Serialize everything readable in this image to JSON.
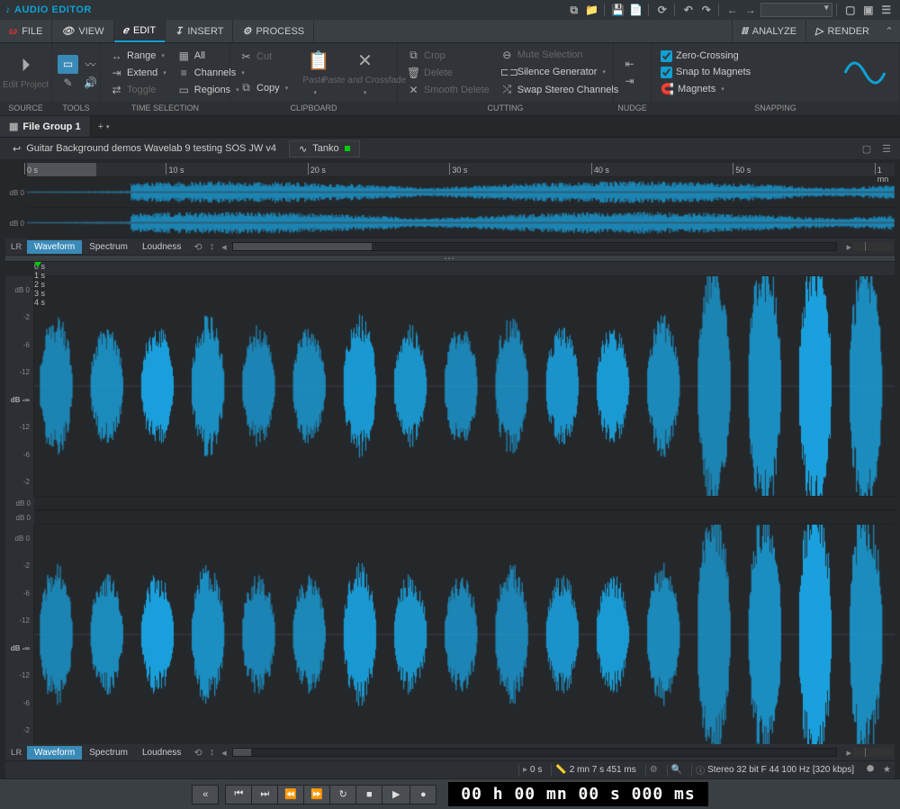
{
  "title": "AUDIO EDITOR",
  "tabs": {
    "file": "FILE",
    "view": "VIEW",
    "edit": "EDIT",
    "insert": "INSERT",
    "process": "PROCESS",
    "analyze": "ANALYZE",
    "render": "RENDER"
  },
  "ribbon": {
    "source": {
      "label": "SOURCE",
      "edit_project": "Edit Project"
    },
    "tools": {
      "label": "TOOLS"
    },
    "time_selection": {
      "label": "TIME SELECTION",
      "range": "Range",
      "all": "All",
      "extend": "Extend",
      "channels": "Channels",
      "toggle": "Toggle",
      "regions": "Regions"
    },
    "clipboard": {
      "label": "CLIPBOARD",
      "cut": "Cut",
      "copy": "Copy",
      "paste": "Paste",
      "paste_crossfade": "Paste and Crossfade"
    },
    "cutting": {
      "label": "CUTTING",
      "crop": "Crop",
      "delete": "Delete",
      "smooth_delete": "Smooth Delete",
      "mute_selection": "Mute Selection",
      "silence_generator": "Silence Generator",
      "swap_stereo": "Swap Stereo Channels"
    },
    "nudge": {
      "label": "NUDGE"
    },
    "snapping": {
      "label": "SNAPPING",
      "zero_crossing": "Zero-Crossing",
      "snap_magnets": "Snap to Magnets",
      "magnets": "Magnets"
    }
  },
  "file_group": "File Group 1",
  "breadcrumb": "Guitar Background demos Wavelab 9 testing SOS JW v4",
  "clip_name": "Tanko",
  "overview_ruler": [
    "0 s",
    "10 s",
    "20 s",
    "30 s",
    "40 s",
    "50 s",
    "1 mn"
  ],
  "detail_ruler": [
    "0 s",
    "1 s",
    "2 s",
    "3 s",
    "4 s"
  ],
  "db_labels": [
    "dB 0",
    "-2",
    "-6",
    "-12",
    "dB -∞",
    "-12",
    "-6",
    "-2"
  ],
  "view_tabs": {
    "waveform": "Waveform",
    "spectrum": "Spectrum",
    "loudness": "Loudness",
    "lr": "LR"
  },
  "status": {
    "pos": "0 s",
    "len": "2 mn 7 s 451 ms",
    "format": "Stereo 32 bit F 44 100 Hz [320 kbps]"
  },
  "timecode": "00 h 00 mn 00 s 000 ms"
}
